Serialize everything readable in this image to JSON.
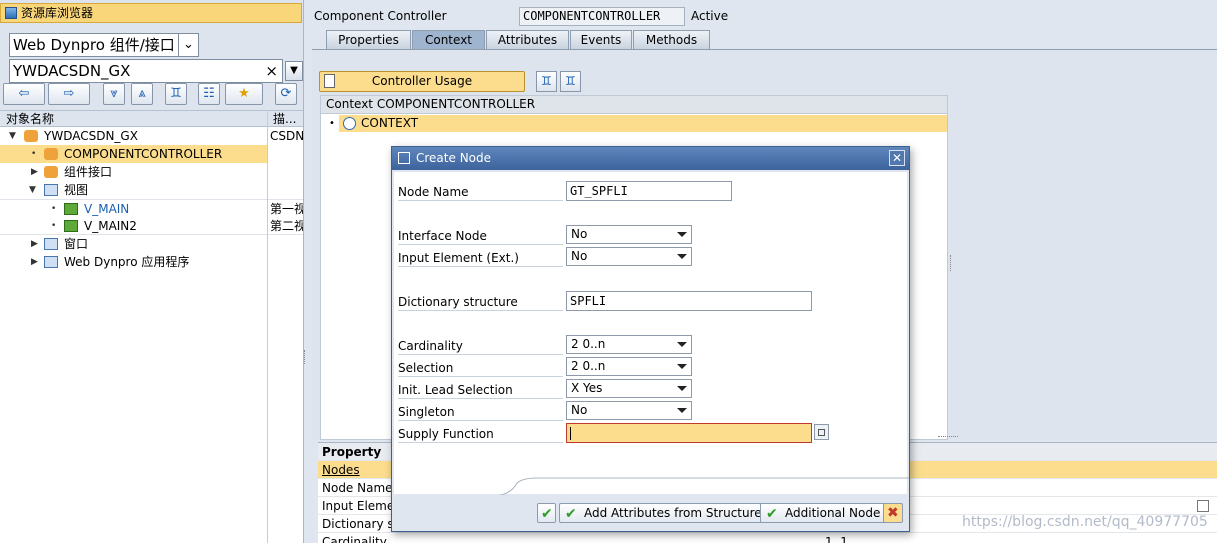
{
  "left_panel": {
    "title": "资源库浏览器",
    "object_type": "Web Dynpro 组件/接口",
    "object_name": "YWDACSDN_GX",
    "clear_symbol": "×",
    "tree_header": {
      "col_name": "对象名称",
      "col_desc": "描..."
    },
    "tree": [
      {
        "label": "YWDACSDN_GX",
        "desc": "CSDN",
        "icon": "component-icon"
      },
      {
        "label": "COMPONENTCONTROLLER",
        "desc": "",
        "icon": "controller-icon",
        "selected": true
      },
      {
        "label": "组件接口",
        "desc": "",
        "icon": "interface-icon"
      },
      {
        "label": "视图",
        "desc": "",
        "icon": "views-folder-icon"
      },
      {
        "label": "V_MAIN",
        "desc": "第一视",
        "icon": "view-icon"
      },
      {
        "label": "V_MAIN2",
        "desc": "第二视",
        "icon": "view-icon"
      },
      {
        "label": "窗口",
        "desc": "",
        "icon": "windows-folder-icon"
      },
      {
        "label": "Web Dynpro 应用程序",
        "desc": "",
        "icon": "application-icon"
      }
    ]
  },
  "header": {
    "label": "Component Controller",
    "name_value": "COMPONENTCONTROLLER",
    "status": "Active"
  },
  "tabs": [
    "Properties",
    "Context",
    "Attributes",
    "Events",
    "Methods"
  ],
  "active_tab": "Context",
  "context": {
    "controller_usage_button": "Controller Usage",
    "panel_title": "Context COMPONENTCONTROLLER",
    "root_node": "CONTEXT"
  },
  "property_panel": {
    "title": "Property",
    "section": "Nodes",
    "rows": [
      "Node Name",
      "Input Eleme",
      "Dictionary st",
      "Cardinality"
    ],
    "cardinality_value": "1..1"
  },
  "dialog": {
    "title": "Create Node",
    "fields": {
      "node_name": {
        "label": "Node Name",
        "value": "GT_SPFLI"
      },
      "interface_node": {
        "label": "Interface Node",
        "value": "No"
      },
      "input_element": {
        "label": "Input Element (Ext.)",
        "value": "No"
      },
      "dictionary_structure": {
        "label": "Dictionary structure",
        "value": "SPFLI"
      },
      "cardinality": {
        "label": "Cardinality",
        "value": "2 0..n"
      },
      "selection": {
        "label": "Selection",
        "value": "2 0..n"
      },
      "init_lead_selection": {
        "label": "Init. Lead Selection",
        "value": "X Yes"
      },
      "singleton": {
        "label": "Singleton",
        "value": "No"
      },
      "supply_function": {
        "label": "Supply Function",
        "value": ""
      }
    },
    "buttons": {
      "add_attributes": "Add Attributes from Structure",
      "additional_node": "Additional Node"
    }
  },
  "watermark": "https://blog.csdn.net/qq_40977705"
}
